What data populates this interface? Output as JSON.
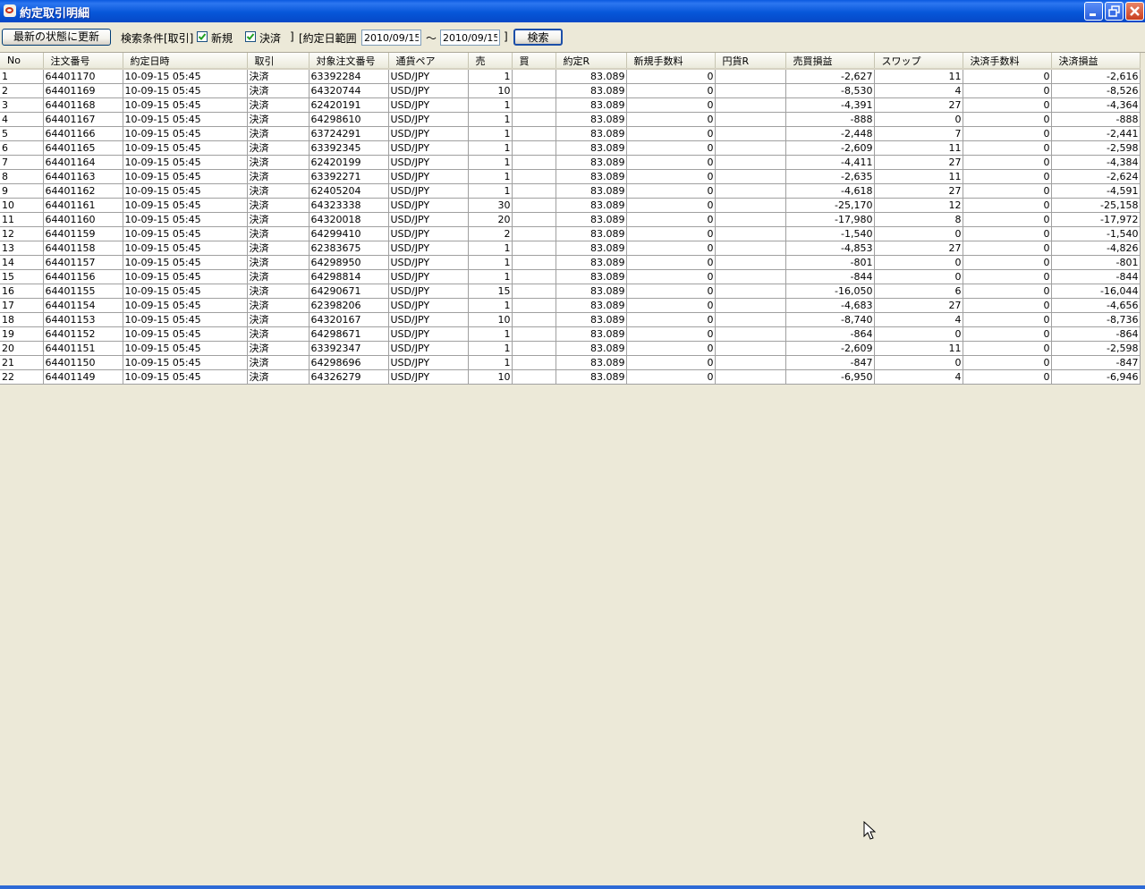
{
  "window": {
    "title": "約定取引明細"
  },
  "toolbar": {
    "refresh_label": "最新の状態に更新",
    "search_condition_label": "検索条件[取引]",
    "new_checkbox_label": "新規",
    "new_checked": true,
    "settle_checkbox_label": "決済",
    "settle_checked": true,
    "bracket_close": "]",
    "date_range_label": "[約定日範囲",
    "date_from": "2010/09/15",
    "tilde": "～",
    "date_to": "2010/09/15",
    "bracket_close2": "]",
    "search_button_label": "検索"
  },
  "table": {
    "columns": [
      "No",
      "注文番号",
      "約定日時",
      "取引",
      "対象注文番号",
      "通貨ペア",
      "売",
      "買",
      "約定R",
      "新規手数料",
      "円貨R",
      "売買損益",
      "スワップ",
      "決済手数料",
      "決済損益"
    ],
    "rows": [
      [
        "1",
        "64401170",
        "10-09-15 05:45",
        "決済",
        "63392284",
        "USD/JPY",
        "1",
        "",
        "83.089",
        "0",
        "",
        "-2,627",
        "11",
        "0",
        "-2,616"
      ],
      [
        "2",
        "64401169",
        "10-09-15 05:45",
        "決済",
        "64320744",
        "USD/JPY",
        "10",
        "",
        "83.089",
        "0",
        "",
        "-8,530",
        "4",
        "0",
        "-8,526"
      ],
      [
        "3",
        "64401168",
        "10-09-15 05:45",
        "決済",
        "62420191",
        "USD/JPY",
        "1",
        "",
        "83.089",
        "0",
        "",
        "-4,391",
        "27",
        "0",
        "-4,364"
      ],
      [
        "4",
        "64401167",
        "10-09-15 05:45",
        "決済",
        "64298610",
        "USD/JPY",
        "1",
        "",
        "83.089",
        "0",
        "",
        "-888",
        "0",
        "0",
        "-888"
      ],
      [
        "5",
        "64401166",
        "10-09-15 05:45",
        "決済",
        "63724291",
        "USD/JPY",
        "1",
        "",
        "83.089",
        "0",
        "",
        "-2,448",
        "7",
        "0",
        "-2,441"
      ],
      [
        "6",
        "64401165",
        "10-09-15 05:45",
        "決済",
        "63392345",
        "USD/JPY",
        "1",
        "",
        "83.089",
        "0",
        "",
        "-2,609",
        "11",
        "0",
        "-2,598"
      ],
      [
        "7",
        "64401164",
        "10-09-15 05:45",
        "決済",
        "62420199",
        "USD/JPY",
        "1",
        "",
        "83.089",
        "0",
        "",
        "-4,411",
        "27",
        "0",
        "-4,384"
      ],
      [
        "8",
        "64401163",
        "10-09-15 05:45",
        "決済",
        "63392271",
        "USD/JPY",
        "1",
        "",
        "83.089",
        "0",
        "",
        "-2,635",
        "11",
        "0",
        "-2,624"
      ],
      [
        "9",
        "64401162",
        "10-09-15 05:45",
        "決済",
        "62405204",
        "USD/JPY",
        "1",
        "",
        "83.089",
        "0",
        "",
        "-4,618",
        "27",
        "0",
        "-4,591"
      ],
      [
        "10",
        "64401161",
        "10-09-15 05:45",
        "決済",
        "64323338",
        "USD/JPY",
        "30",
        "",
        "83.089",
        "0",
        "",
        "-25,170",
        "12",
        "0",
        "-25,158"
      ],
      [
        "11",
        "64401160",
        "10-09-15 05:45",
        "決済",
        "64320018",
        "USD/JPY",
        "20",
        "",
        "83.089",
        "0",
        "",
        "-17,980",
        "8",
        "0",
        "-17,972"
      ],
      [
        "12",
        "64401159",
        "10-09-15 05:45",
        "決済",
        "64299410",
        "USD/JPY",
        "2",
        "",
        "83.089",
        "0",
        "",
        "-1,540",
        "0",
        "0",
        "-1,540"
      ],
      [
        "13",
        "64401158",
        "10-09-15 05:45",
        "決済",
        "62383675",
        "USD/JPY",
        "1",
        "",
        "83.089",
        "0",
        "",
        "-4,853",
        "27",
        "0",
        "-4,826"
      ],
      [
        "14",
        "64401157",
        "10-09-15 05:45",
        "決済",
        "64298950",
        "USD/JPY",
        "1",
        "",
        "83.089",
        "0",
        "",
        "-801",
        "0",
        "0",
        "-801"
      ],
      [
        "15",
        "64401156",
        "10-09-15 05:45",
        "決済",
        "64298814",
        "USD/JPY",
        "1",
        "",
        "83.089",
        "0",
        "",
        "-844",
        "0",
        "0",
        "-844"
      ],
      [
        "16",
        "64401155",
        "10-09-15 05:45",
        "決済",
        "64290671",
        "USD/JPY",
        "15",
        "",
        "83.089",
        "0",
        "",
        "-16,050",
        "6",
        "0",
        "-16,044"
      ],
      [
        "17",
        "64401154",
        "10-09-15 05:45",
        "決済",
        "62398206",
        "USD/JPY",
        "1",
        "",
        "83.089",
        "0",
        "",
        "-4,683",
        "27",
        "0",
        "-4,656"
      ],
      [
        "18",
        "64401153",
        "10-09-15 05:45",
        "決済",
        "64320167",
        "USD/JPY",
        "10",
        "",
        "83.089",
        "0",
        "",
        "-8,740",
        "4",
        "0",
        "-8,736"
      ],
      [
        "19",
        "64401152",
        "10-09-15 05:45",
        "決済",
        "64298671",
        "USD/JPY",
        "1",
        "",
        "83.089",
        "0",
        "",
        "-864",
        "0",
        "0",
        "-864"
      ],
      [
        "20",
        "64401151",
        "10-09-15 05:45",
        "決済",
        "63392347",
        "USD/JPY",
        "1",
        "",
        "83.089",
        "0",
        "",
        "-2,609",
        "11",
        "0",
        "-2,598"
      ],
      [
        "21",
        "64401150",
        "10-09-15 05:45",
        "決済",
        "64298696",
        "USD/JPY",
        "1",
        "",
        "83.089",
        "0",
        "",
        "-847",
        "0",
        "0",
        "-847"
      ],
      [
        "22",
        "64401149",
        "10-09-15 05:45",
        "決済",
        "64326279",
        "USD/JPY",
        "10",
        "",
        "83.089",
        "0",
        "",
        "-6,950",
        "4",
        "0",
        "-6,946"
      ]
    ]
  },
  "colors": {
    "titlebar": "#0757d9",
    "window_bg": "#ece9d8",
    "grid_line": "#a0a0a0"
  }
}
